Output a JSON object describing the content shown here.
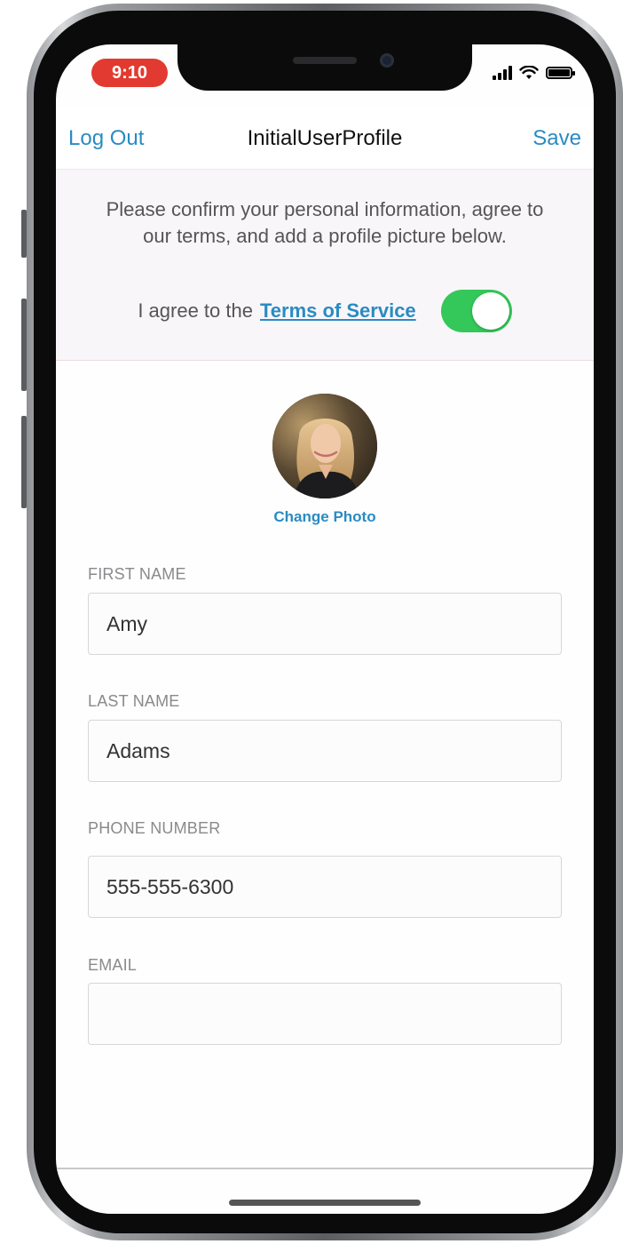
{
  "status": {
    "time": "9:10"
  },
  "navbar": {
    "left": "Log Out",
    "title": "InitialUserProfile",
    "right": "Save"
  },
  "banner": {
    "message": "Please confirm your personal information, agree to our terms, and add a profile picture below.",
    "agree_label": "I agree to the",
    "terms_link": "Terms of Service",
    "toggle_on": true
  },
  "profile": {
    "change_photo": "Change Photo"
  },
  "fields": {
    "first_name": {
      "label": "FIRST NAME",
      "value": "Amy"
    },
    "last_name": {
      "label": "LAST NAME",
      "value": "Adams"
    },
    "phone": {
      "label": "PHONE NUMBER",
      "value": "555-555-6300"
    },
    "email": {
      "label": "EMAIL",
      "value": ""
    }
  },
  "colors": {
    "accent": "#2a8bc2",
    "toggle": "#34c759",
    "time_pill": "#e23a30"
  },
  "icons": [
    "signal-icon",
    "wifi-icon",
    "battery-icon"
  ]
}
